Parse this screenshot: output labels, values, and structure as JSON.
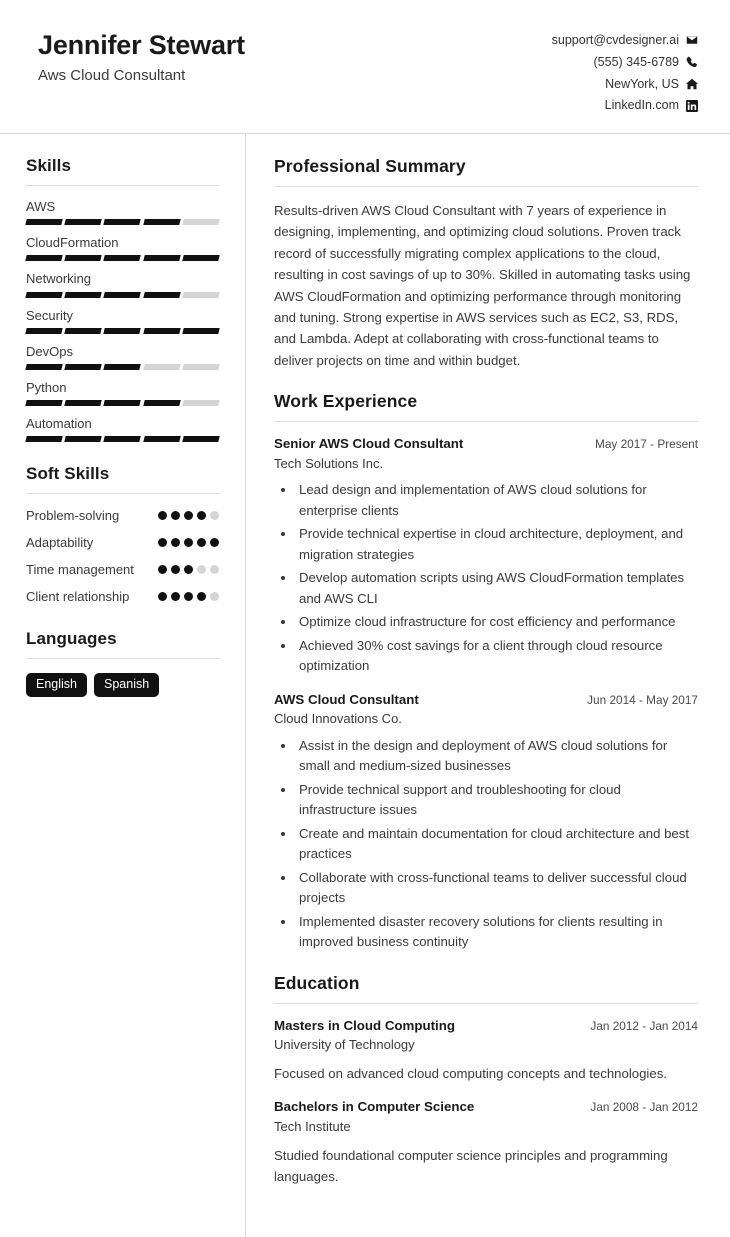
{
  "header": {
    "name": "Jennifer Stewart",
    "job_title": "Aws Cloud Consultant",
    "contacts": [
      {
        "text": "support@cvdesigner.ai",
        "icon": "email-icon"
      },
      {
        "text": "(555) 345-6789",
        "icon": "phone-icon"
      },
      {
        "text": "NewYork, US",
        "icon": "home-icon"
      },
      {
        "text": "LinkedIn.com",
        "icon": "linkedin-icon"
      }
    ]
  },
  "sidebar": {
    "skills": {
      "title": "Skills",
      "max": 5,
      "items": [
        {
          "label": "AWS",
          "level": 4
        },
        {
          "label": "CloudFormation",
          "level": 5
        },
        {
          "label": "Networking",
          "level": 4
        },
        {
          "label": "Security",
          "level": 5
        },
        {
          "label": "DevOps",
          "level": 3
        },
        {
          "label": "Python",
          "level": 4
        },
        {
          "label": "Automation",
          "level": 5
        }
      ]
    },
    "soft_skills": {
      "title": "Soft Skills",
      "max": 5,
      "items": [
        {
          "label": "Problem-solving",
          "level": 4
        },
        {
          "label": "Adaptability",
          "level": 5
        },
        {
          "label": "Time management",
          "level": 3
        },
        {
          "label": "Client relationship",
          "level": 4
        }
      ]
    },
    "languages": {
      "title": "Languages",
      "items": [
        "English",
        "Spanish"
      ]
    }
  },
  "main": {
    "summary": {
      "title": "Professional Summary",
      "text": "Results-driven AWS Cloud Consultant with 7 years of experience in designing, implementing, and optimizing cloud solutions. Proven track record of successfully migrating complex applications to the cloud, resulting in cost savings of up to 30%. Skilled in automating tasks using AWS CloudFormation and optimizing performance through monitoring and tuning. Strong expertise in AWS services such as EC2, S3, RDS, and Lambda. Adept at collaborating with cross-functional teams to deliver projects on time and within budget."
    },
    "work_experience": {
      "title": "Work Experience",
      "entries": [
        {
          "role": "Senior AWS Cloud Consultant",
          "date": "May 2017 - Present",
          "org": "Tech Solutions Inc.",
          "bullets": [
            "Lead design and implementation of AWS cloud solutions for enterprise clients",
            "Provide technical expertise in cloud architecture, deployment, and migration strategies",
            "Develop automation scripts using AWS CloudFormation templates and AWS CLI",
            "Optimize cloud infrastructure for cost efficiency and performance",
            "Achieved 30% cost savings for a client through cloud resource optimization"
          ]
        },
        {
          "role": "AWS Cloud Consultant",
          "date": "Jun 2014 - May 2017",
          "org": "Cloud Innovations Co.",
          "bullets": [
            "Assist in the design and deployment of AWS cloud solutions for small and medium-sized businesses",
            "Provide technical support and troubleshooting for cloud infrastructure issues",
            "Create and maintain documentation for cloud architecture and best practices",
            "Collaborate with cross-functional teams to deliver successful cloud projects",
            "Implemented disaster recovery solutions for clients resulting in improved business continuity"
          ]
        }
      ]
    },
    "education": {
      "title": "Education",
      "entries": [
        {
          "degree": "Masters in Cloud Computing",
          "date": "Jan 2012 - Jan 2014",
          "school": "University of Technology",
          "description": "Focused on advanced cloud computing concepts and technologies."
        },
        {
          "degree": "Bachelors in Computer Science",
          "date": "Jan 2008 - Jan 2012",
          "school": "Tech Institute",
          "description": "Studied foundational computer science principles and programming languages."
        }
      ]
    }
  },
  "colors": {
    "filled": "#111111",
    "empty": "#d5d5d5",
    "pill_bg": "#111111",
    "pill_text": "#ffffff",
    "rule": "#d8d8d8"
  }
}
